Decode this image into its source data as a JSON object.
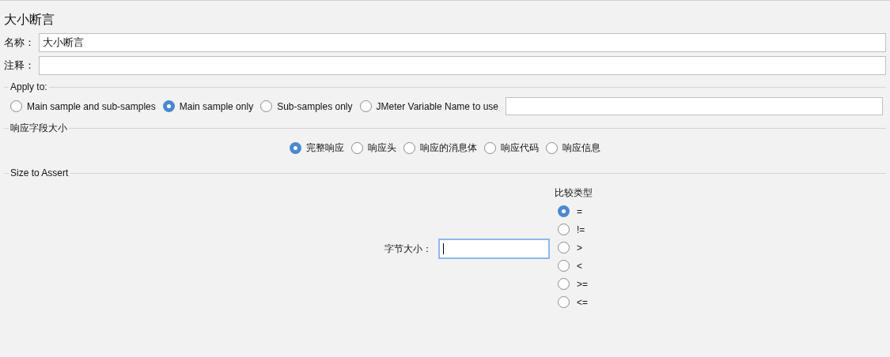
{
  "title": "大小断言",
  "fields": [
    {
      "label": "名称：",
      "value": "大小断言"
    },
    {
      "label": "注释："
    }
  ],
  "apply_to": {
    "legend": "Apply to:",
    "options": [
      {
        "label": "Main sample and sub-samples",
        "selected": false
      },
      {
        "label": "Main sample only",
        "selected": true
      },
      {
        "label": "Sub-samples only",
        "selected": false
      },
      {
        "label": "JMeter Variable Name to use",
        "selected": false
      }
    ]
  },
  "response_field": {
    "legend": "响应字段大小",
    "options": [
      {
        "label": "完整响应",
        "selected": true
      },
      {
        "label": "响应头",
        "selected": false
      },
      {
        "label": "响应的消息体",
        "selected": false
      },
      {
        "label": "响应代码",
        "selected": false
      },
      {
        "label": "响应信息",
        "selected": false
      }
    ]
  },
  "size_to_assert": {
    "legend": "Size to Assert",
    "size_label": "字节大小：",
    "size_focused": true,
    "compare_title": "比较类型",
    "compare_options": [
      {
        "label": "=",
        "selected": true
      },
      {
        "label": "!=",
        "selected": false
      },
      {
        "label": ">",
        "selected": false
      },
      {
        "label": "<",
        "selected": false
      },
      {
        "label": ">=",
        "selected": false
      },
      {
        "label": "<=",
        "selected": false
      }
    ]
  }
}
